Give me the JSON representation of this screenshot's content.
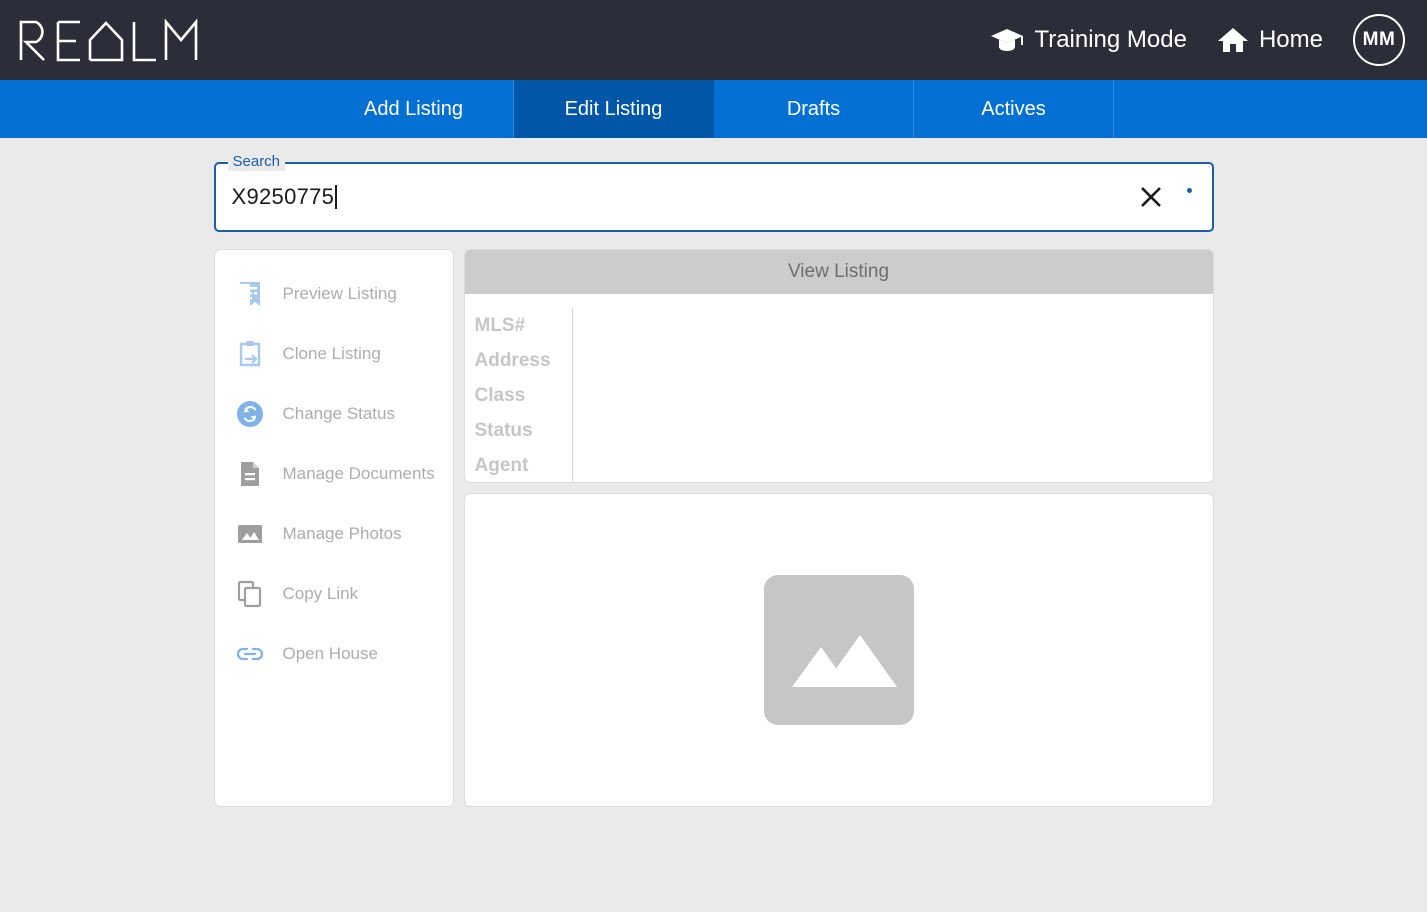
{
  "header": {
    "logo_text": "REALM",
    "training_mode_label": "Training Mode",
    "training_mode_icon": "graduation-cap-icon",
    "home_label": "Home",
    "home_icon": "home-icon",
    "avatar_initials": "MM",
    "background_color": "#2b2e38"
  },
  "nav": {
    "background_color": "#0570d4",
    "active_color": "#0156a8",
    "tabs": [
      {
        "label": "Add Listing",
        "active": false
      },
      {
        "label": "Edit Listing",
        "active": true
      },
      {
        "label": "Drafts",
        "active": false
      },
      {
        "label": "Actives",
        "active": false
      }
    ]
  },
  "search": {
    "legend": "Search",
    "value": "X9250775",
    "placeholder": "",
    "clear_icon": "close-icon",
    "accent_color": "#1a5fa8"
  },
  "sidebar": {
    "items": [
      {
        "label": "Preview Listing",
        "icon": "receipt-icon",
        "color": "#a8c8ec",
        "disabled": true
      },
      {
        "label": "Clone Listing",
        "icon": "clipboard-arrow-icon",
        "color": "#a8c8ec",
        "disabled": true
      },
      {
        "label": "Change Status",
        "icon": "sync-circle-icon",
        "color": "#7fb3e8",
        "disabled": true
      },
      {
        "label": "Manage Documents",
        "icon": "document-icon",
        "color": "#9e9e9e",
        "disabled": true
      },
      {
        "label": "Manage Photos",
        "icon": "image-icon",
        "color": "#9e9e9e",
        "disabled": true
      },
      {
        "label": "Copy Link",
        "icon": "copy-icon",
        "color": "#9e9e9e",
        "disabled": true
      },
      {
        "label": "Open House",
        "icon": "link-chain-icon",
        "color": "#7fb3e8",
        "disabled": true
      }
    ]
  },
  "detail": {
    "header_title": "View Listing",
    "header_color": "#cccccc",
    "rows": [
      {
        "label": "MLS#",
        "value": ""
      },
      {
        "label": "Address",
        "value": ""
      },
      {
        "label": "Class",
        "value": ""
      },
      {
        "label": "Status",
        "value": ""
      },
      {
        "label": "Agent",
        "value": ""
      }
    ]
  },
  "photo": {
    "placeholder_icon": "image-placeholder-icon",
    "placeholder_color": "#c6c6c6"
  }
}
